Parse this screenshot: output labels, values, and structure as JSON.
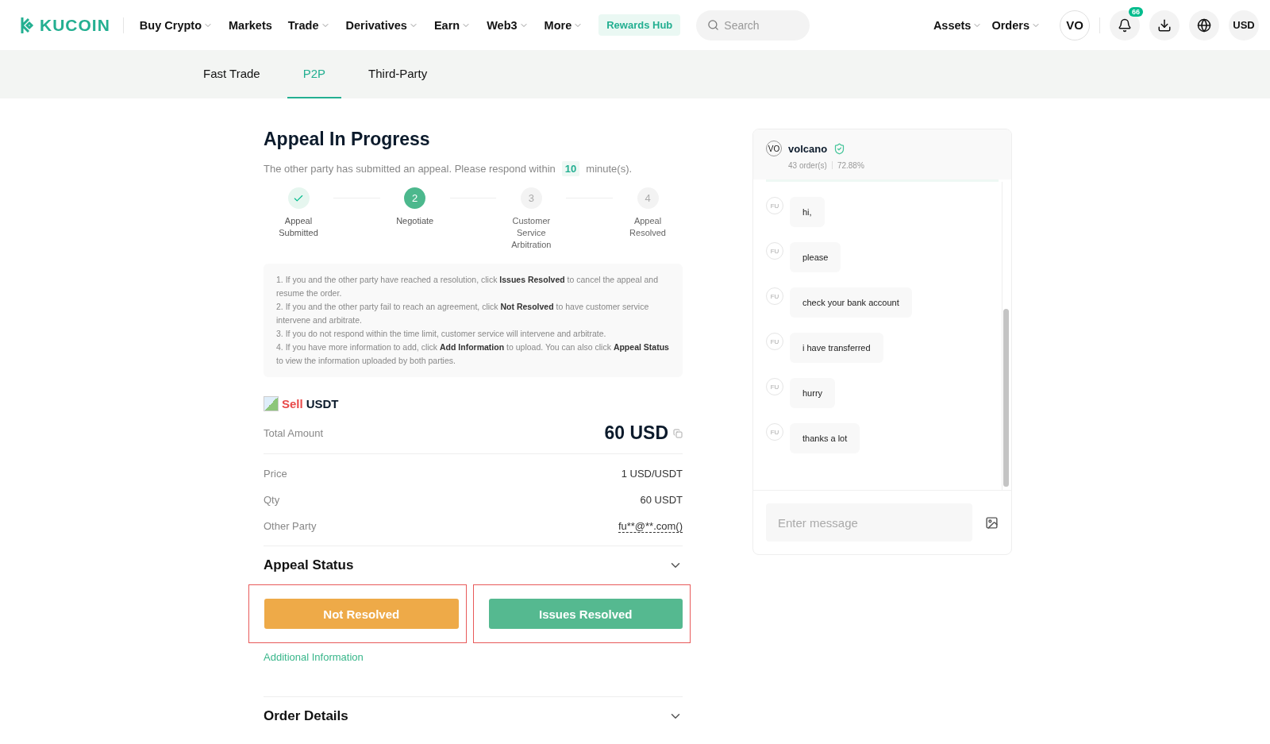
{
  "nav": {
    "logo": "KUCOIN",
    "menu": [
      {
        "label": "Buy Crypto",
        "dropdown": true
      },
      {
        "label": "Markets",
        "dropdown": false
      },
      {
        "label": "Trade",
        "dropdown": true
      },
      {
        "label": "Derivatives",
        "dropdown": true
      },
      {
        "label": "Earn",
        "dropdown": true
      },
      {
        "label": "Web3",
        "dropdown": true
      },
      {
        "label": "More",
        "dropdown": true
      }
    ],
    "rewards": "Rewards Hub",
    "search_placeholder": "Search",
    "right": [
      {
        "label": "Assets",
        "dropdown": true
      },
      {
        "label": "Orders",
        "dropdown": true
      }
    ],
    "avatar": "VO",
    "notification_count": "66",
    "currency": "USD"
  },
  "subtabs": [
    {
      "label": "Fast Trade",
      "selected": false
    },
    {
      "label": "P2P",
      "selected": true
    },
    {
      "label": "Third-Party",
      "selected": false
    }
  ],
  "appeal": {
    "title": "Appeal In Progress",
    "notice_before": "The other party has submitted an appeal. Please respond within",
    "minutes": "10",
    "notice_after": "minute(s).",
    "steps": [
      {
        "label": "Appeal Submitted",
        "completed": true,
        "selected": false
      },
      {
        "number": "2",
        "label": "Negotiate",
        "completed": false,
        "selected": true
      },
      {
        "number": "3",
        "label": "Customer Service Arbitration",
        "completed": false,
        "selected": false
      },
      {
        "number": "4",
        "label": "Appeal Resolved",
        "completed": false,
        "selected": false
      }
    ],
    "instructions": [
      "1. If you and the other party have reached a resolution, click **Issues Resolved** to cancel the appeal and resume the order.",
      "2. If you and the other party fail to reach an agreement, click **Not Resolved** to have customer service intervene and arbitrate.",
      "3. If you do not respond within the time limit, customer service will intervene and arbitrate.",
      "4. If you have more information to add, click **Add Information** to upload. You can also click **Appeal Status** to view the information uploaded by both parties."
    ],
    "side": "Sell",
    "asset": "USDT",
    "total_label": "Total Amount",
    "total_value": "60 USD",
    "details": [
      {
        "label": "Price",
        "value": "1 USD/USDT",
        "kind": "text"
      },
      {
        "label": "Qty",
        "value": "60 USDT",
        "kind": "text"
      },
      {
        "label": "Other Party",
        "value": "fu**@**.com()",
        "kind": "link"
      }
    ],
    "status_section": "Appeal Status",
    "buttons": [
      {
        "label": "Not Resolved",
        "kind": "warning",
        "highlighted": true
      },
      {
        "label": "Issues Resolved",
        "kind": "primary",
        "highlighted": true
      }
    ],
    "additional_link": "Additional Information",
    "order_section": "Order Details"
  },
  "chat": {
    "avatar": "VO",
    "name": "volcano",
    "verified": true,
    "orders": "43 order(s)",
    "rate": "72.88%",
    "messages": [
      {
        "avatar": "FU",
        "text": "hi,"
      },
      {
        "avatar": "FU",
        "text": "please"
      },
      {
        "avatar": "FU",
        "text": "check your bank account"
      },
      {
        "avatar": "FU",
        "text": "i have transferred"
      },
      {
        "avatar": "FU",
        "text": "hurry"
      },
      {
        "avatar": "FU",
        "text": "thanks a lot"
      }
    ],
    "placeholder": "Enter message"
  }
}
